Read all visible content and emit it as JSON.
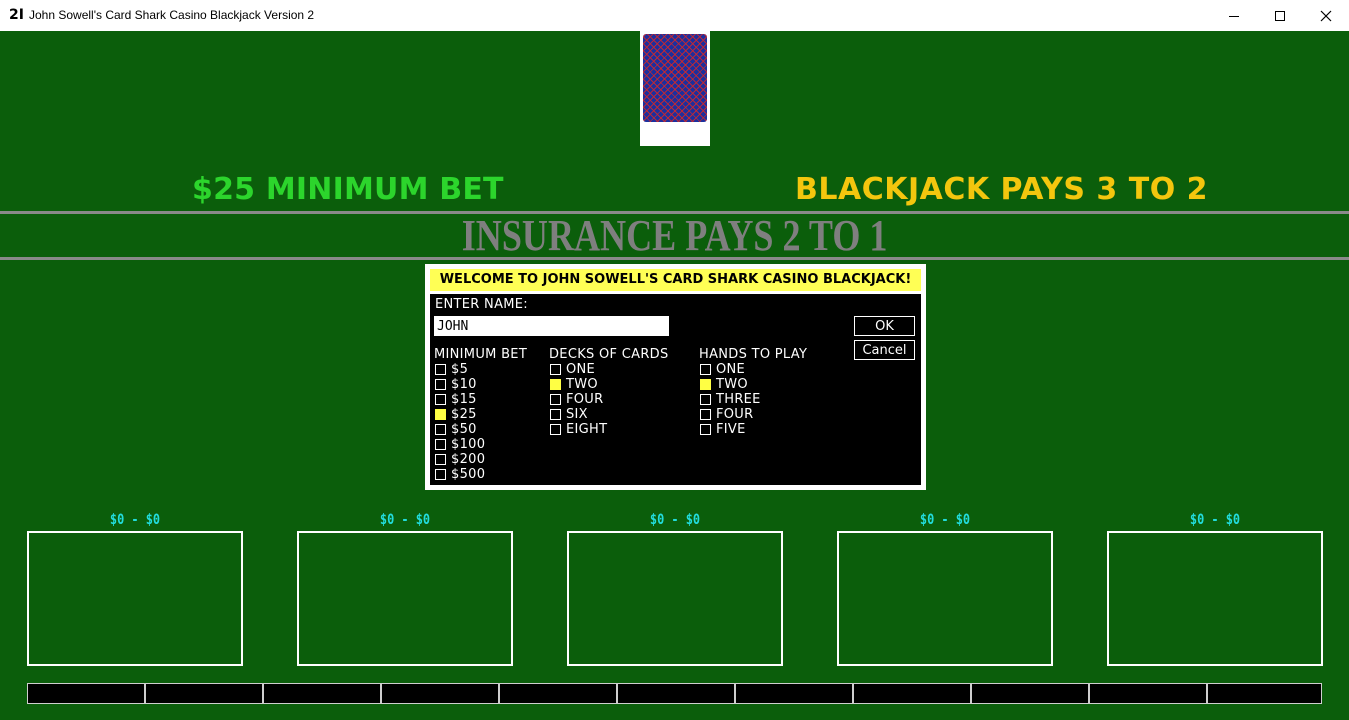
{
  "window": {
    "app_icon": "2I",
    "title": "John Sowell's Card Shark Casino Blackjack Version 2",
    "controls": [
      "minimize-icon",
      "maximize-icon",
      "close-icon"
    ]
  },
  "table": {
    "min_bet_banner": "$25 MINIMUM BET",
    "blackjack_banner": "BLACKJACK PAYS 3 TO 2",
    "insurance_banner": "INSURANCE PAYS 2 TO 1",
    "colors": {
      "felt": "#0b5e0b",
      "min_bet": "#2cd52c",
      "blackjack": "#f3c60e",
      "insurance": "#7f7f7f",
      "hand_label": "#22dddd"
    }
  },
  "dialog": {
    "welcome": "WELCOME TO JOHN SOWELL'S CARD SHARK CASINO BLACKJACK!",
    "name_label": "ENTER NAME:",
    "name_value": "JOHN",
    "ok_label": "OK",
    "cancel_label": "Cancel",
    "min_bet": {
      "header": "MINIMUM BET",
      "options": [
        {
          "label": "$5",
          "checked": false
        },
        {
          "label": "$10",
          "checked": false
        },
        {
          "label": "$15",
          "checked": false
        },
        {
          "label": "$25",
          "checked": true
        },
        {
          "label": "$50",
          "checked": false
        },
        {
          "label": "$100",
          "checked": false
        },
        {
          "label": "$200",
          "checked": false
        },
        {
          "label": "$500",
          "checked": false
        }
      ]
    },
    "decks": {
      "header": "DECKS OF CARDS",
      "options": [
        {
          "label": "ONE",
          "checked": false
        },
        {
          "label": "TWO",
          "checked": true
        },
        {
          "label": "FOUR",
          "checked": false
        },
        {
          "label": "SIX",
          "checked": false
        },
        {
          "label": "EIGHT",
          "checked": false
        }
      ]
    },
    "hands": {
      "header": "HANDS TO PLAY",
      "options": [
        {
          "label": "ONE",
          "checked": false
        },
        {
          "label": "TWO",
          "checked": true
        },
        {
          "label": "THREE",
          "checked": false
        },
        {
          "label": "FOUR",
          "checked": false
        },
        {
          "label": "FIVE",
          "checked": false
        }
      ]
    }
  },
  "hands": [
    {
      "label": "$0 - $0"
    },
    {
      "label": "$0 - $0"
    },
    {
      "label": "$0 - $0"
    },
    {
      "label": "$0 - $0"
    },
    {
      "label": "$0 - $0"
    }
  ]
}
